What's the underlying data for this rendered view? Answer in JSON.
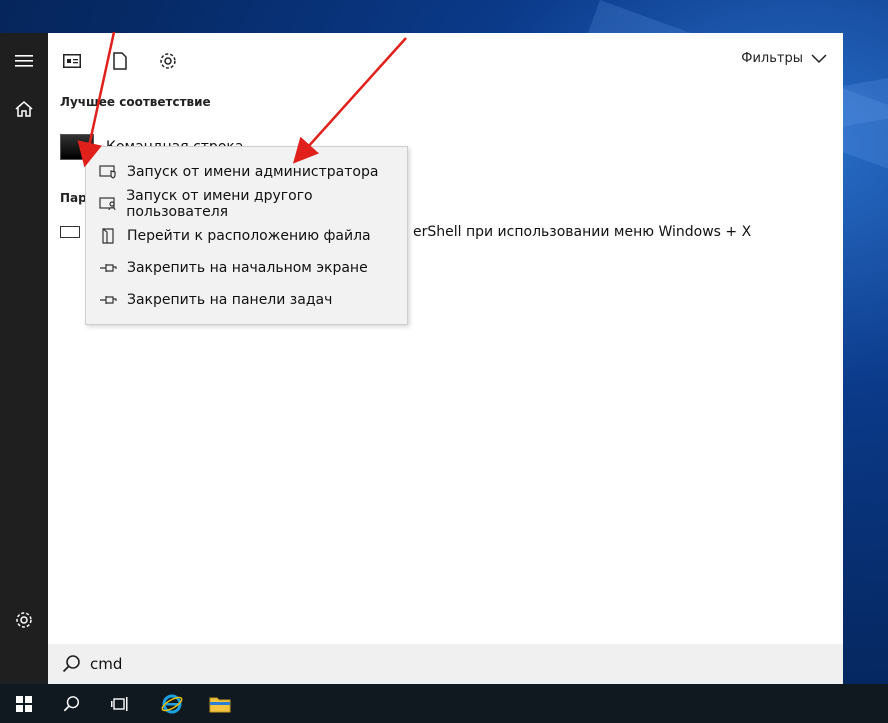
{
  "start_menu": {
    "topbar": {
      "icons": [
        "apps-icon",
        "documents-icon",
        "settings-gear-icon"
      ],
      "filters_label": "Фильтры"
    },
    "best_match": {
      "title": "Лучшее соответствие",
      "item_label": "Командная строка"
    },
    "settings_section": {
      "title_partial": "Пара",
      "item_label_tail": "erShell при использовании меню Windows + X"
    },
    "search": {
      "value": "cmd"
    }
  },
  "context_menu": {
    "items": [
      {
        "label": "Запуск от имени администратора",
        "icon": "shield-icon"
      },
      {
        "label": "Запуск от имени другого пользователя",
        "icon": "user-run-icon"
      },
      {
        "label": "Перейти к расположению файла",
        "icon": "open-folder-icon"
      },
      {
        "label": "Закрепить на начальном экране",
        "icon": "pin-icon"
      },
      {
        "label": "Закрепить на панели задач",
        "icon": "pin-icon"
      }
    ]
  },
  "taskbar": {
    "items": [
      "windows-start-icon",
      "search-icon",
      "task-view-icon",
      "internet-explorer-icon",
      "file-explorer-icon"
    ]
  },
  "colors": {
    "annotation_arrow": "#e0201b",
    "menu_bg": "#ffffff",
    "rail_bg": "#1f1f1f",
    "context_bg": "#f2f2f2"
  }
}
